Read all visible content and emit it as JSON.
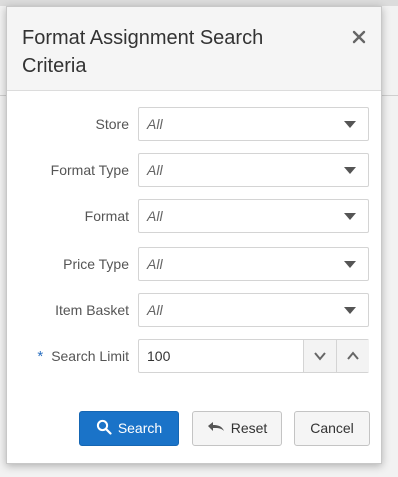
{
  "dialog": {
    "title": "Format Assignment Search Criteria",
    "close_icon": "close-icon"
  },
  "fields": [
    {
      "label": "Store",
      "value": "All",
      "type": "select"
    },
    {
      "label": "Format Type",
      "value": "All",
      "type": "select"
    },
    {
      "label": "Format",
      "value": "All",
      "type": "select"
    },
    {
      "label": "Price Type",
      "value": "All",
      "type": "select"
    },
    {
      "label": "Item Basket",
      "value": "All",
      "type": "select"
    }
  ],
  "search_limit": {
    "required_mark": "*",
    "label": "Search Limit",
    "value": "100"
  },
  "buttons": {
    "search_label": "Search",
    "search_icon": "search-icon",
    "reset_label": "Reset",
    "reset_icon": "undo-arrow-icon",
    "cancel_label": "Cancel"
  },
  "colors": {
    "primary": "#1a73c8",
    "required": "#2a6fc0",
    "header_bg": "#f5f5f5"
  }
}
